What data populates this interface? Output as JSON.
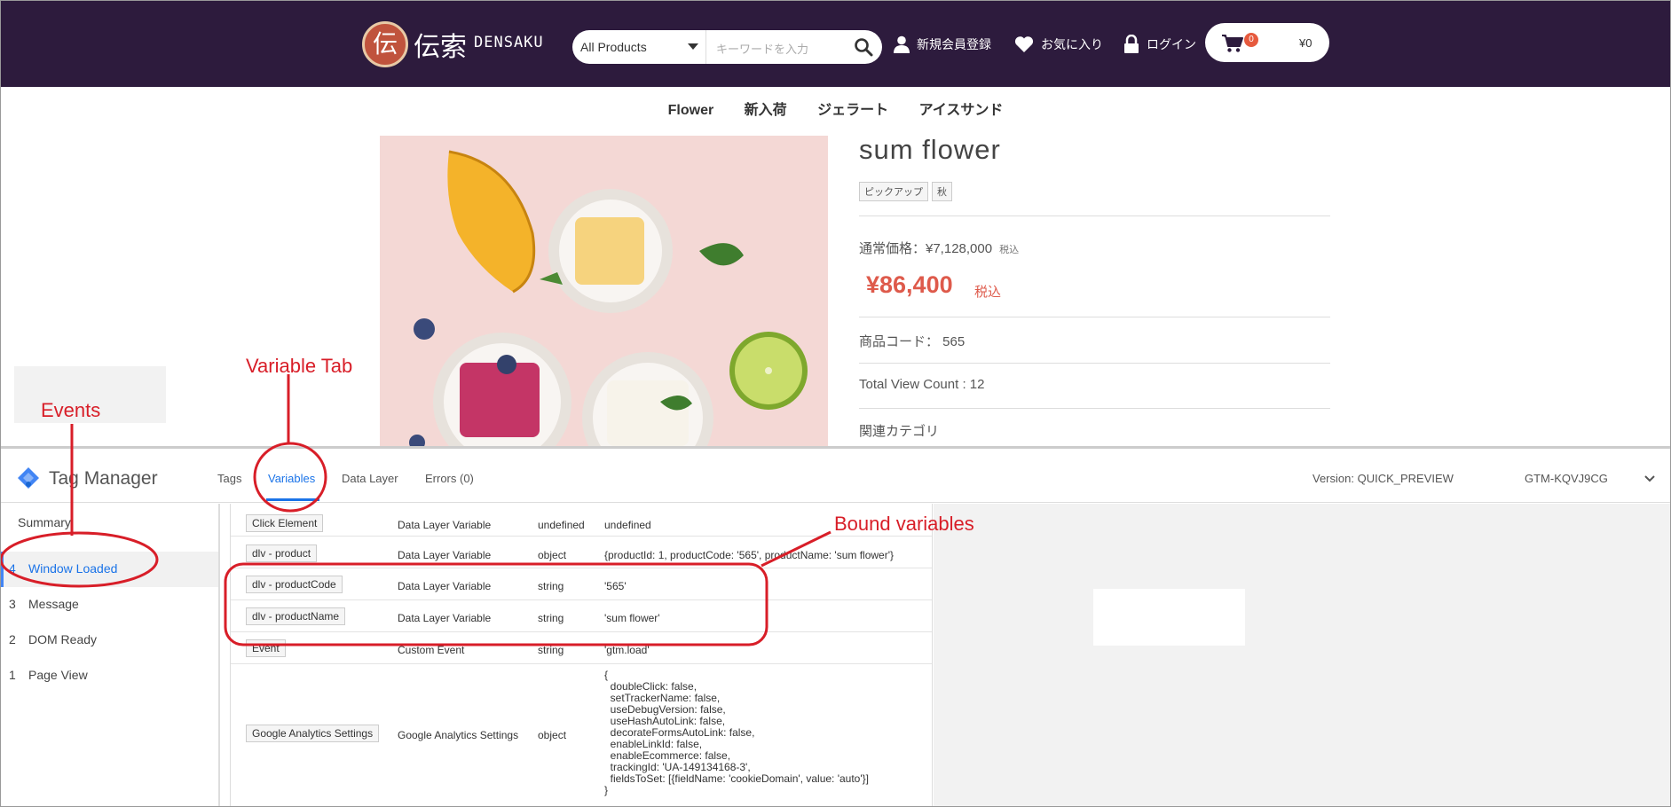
{
  "store_header": {
    "logo_jp": "伝索",
    "logo_en": "DENSAKU",
    "category_select": "All Products",
    "search_placeholder": "キーワードを入力",
    "register_label": "新規会員登録",
    "favorites_label": "お気に入り",
    "login_label": "ログイン",
    "cart_count": "0",
    "cart_total": "¥0"
  },
  "category_nav": [
    "Flower",
    "新入荷",
    "ジェラート",
    "アイスサンド"
  ],
  "product": {
    "title": "sum flower",
    "tags": [
      "ピックアップ",
      "秋"
    ],
    "list_price": "通常価格：¥7,128,000",
    "list_price_tax": "税込",
    "sale_price": "¥86,400",
    "sale_tax": "税込",
    "product_code": "商品コード： 565",
    "view_count": "Total View Count : 12",
    "related_category": "関連カテゴリ"
  },
  "tag_manager": {
    "title": "Tag Manager",
    "tabs": [
      "Tags",
      "Variables",
      "Data Layer",
      "Errors (0)"
    ],
    "active_tab": "Variables",
    "version": "Version: QUICK_PREVIEW",
    "container_id": "GTM-KQVJ9CG",
    "sidebar": {
      "summary": "Summary",
      "events": [
        {
          "num": "4",
          "label": "Window Loaded",
          "active": true
        },
        {
          "num": "3",
          "label": "Message"
        },
        {
          "num": "2",
          "label": "DOM Ready"
        },
        {
          "num": "1",
          "label": "Page View"
        }
      ]
    },
    "variables": [
      {
        "name": "Click Element",
        "type": "Data Layer Variable",
        "dtype": "undefined",
        "value": "undefined"
      },
      {
        "name": "dlv - product",
        "type": "Data Layer Variable",
        "dtype": "object",
        "value": "{productId: 1, productCode: '565', productName: 'sum flower'}"
      },
      {
        "name": "dlv - productCode",
        "type": "Data Layer Variable",
        "dtype": "string",
        "value": "'565'"
      },
      {
        "name": "dlv - productName",
        "type": "Data Layer Variable",
        "dtype": "string",
        "value": "'sum flower'"
      },
      {
        "name": "Event",
        "type": "Custom Event",
        "dtype": "string",
        "value": "'gtm.load'"
      },
      {
        "name": "Google Analytics Settings",
        "type": "Google Analytics Settings",
        "dtype": "object",
        "value": "{\n  doubleClick: false,\n  setTrackerName: false,\n  useDebugVersion: false,\n  useHashAutoLink: false,\n  decorateFormsAutoLink: false,\n  enableLinkId: false,\n  enableEcommerce: false,\n  trackingId: 'UA-149134168-3',\n  fieldsToSet: [{fieldName: 'cookieDomain', value: 'auto'}]\n}"
      }
    ]
  },
  "annotations": {
    "events": "Events",
    "variable_tab": "Variable Tab",
    "bound_variables": "Bound variables",
    "color": "#d81e28"
  }
}
